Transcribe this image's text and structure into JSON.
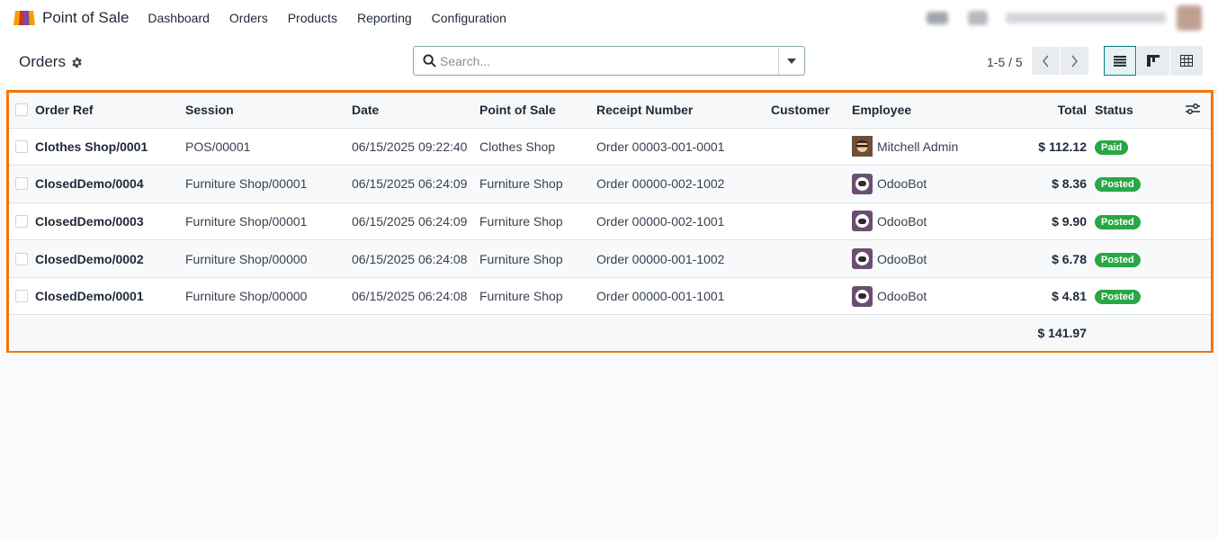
{
  "app": {
    "title": "Point of Sale"
  },
  "menu": [
    {
      "name": "menu-dashboard",
      "label": "Dashboard"
    },
    {
      "name": "menu-orders",
      "label": "Orders"
    },
    {
      "name": "menu-products",
      "label": "Products"
    },
    {
      "name": "menu-reporting",
      "label": "Reporting"
    },
    {
      "name": "menu-configuration",
      "label": "Configuration"
    }
  ],
  "breadcrumb": {
    "title": "Orders"
  },
  "search": {
    "placeholder": "Search..."
  },
  "pager": {
    "text": "1-5 / 5"
  },
  "colors": {
    "accent": "#017e84",
    "highlight_frame": "#f47506",
    "badge_green": "#28a745"
  },
  "table": {
    "columns": [
      "Order Ref",
      "Session",
      "Date",
      "Point of Sale",
      "Receipt Number",
      "Customer",
      "Employee",
      "Total",
      "Status"
    ],
    "rows": [
      {
        "ref": "Clothes Shop/0001",
        "session": "POS/00001",
        "date": "06/15/2025 09:22:40",
        "pos": "Clothes Shop",
        "receipt": "Order 00003-001-0001",
        "customer": "",
        "employee": "Mitchell Admin",
        "employee_avatar": "human",
        "total": "$ 112.12",
        "status": "Paid"
      },
      {
        "ref": "ClosedDemo/0004",
        "session": "Furniture Shop/00001",
        "date": "06/15/2025 06:24:09",
        "pos": "Furniture Shop",
        "receipt": "Order 00000-002-1002",
        "customer": "",
        "employee": "OdooBot",
        "employee_avatar": "bot",
        "total": "$ 8.36",
        "status": "Posted"
      },
      {
        "ref": "ClosedDemo/0003",
        "session": "Furniture Shop/00001",
        "date": "06/15/2025 06:24:09",
        "pos": "Furniture Shop",
        "receipt": "Order 00000-002-1001",
        "customer": "",
        "employee": "OdooBot",
        "employee_avatar": "bot",
        "total": "$ 9.90",
        "status": "Posted"
      },
      {
        "ref": "ClosedDemo/0002",
        "session": "Furniture Shop/00000",
        "date": "06/15/2025 06:24:08",
        "pos": "Furniture Shop",
        "receipt": "Order 00000-001-1002",
        "customer": "",
        "employee": "OdooBot",
        "employee_avatar": "bot",
        "total": "$ 6.78",
        "status": "Posted"
      },
      {
        "ref": "ClosedDemo/0001",
        "session": "Furniture Shop/00000",
        "date": "06/15/2025 06:24:08",
        "pos": "Furniture Shop",
        "receipt": "Order 00000-001-1001",
        "customer": "",
        "employee": "OdooBot",
        "employee_avatar": "bot",
        "total": "$ 4.81",
        "status": "Posted"
      }
    ],
    "footer_total": "$ 141.97"
  }
}
